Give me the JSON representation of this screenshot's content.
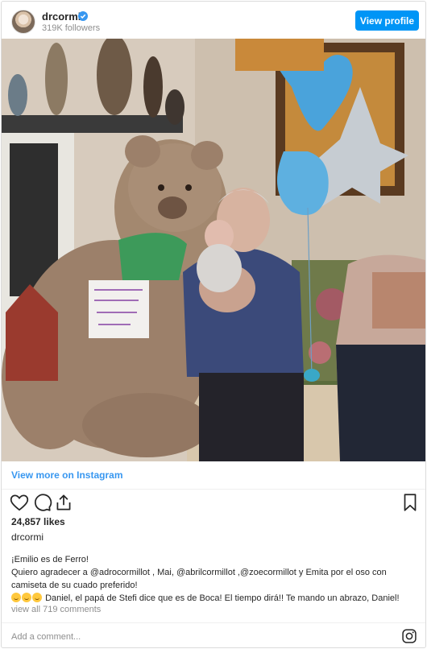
{
  "header": {
    "username": "drcormi",
    "followers": "319K followers",
    "view_profile_label": "View profile"
  },
  "post": {
    "view_more_label": "View more on Instagram",
    "likes": "24,857 likes",
    "owner": "drcormi",
    "caption_line1": "¡Emilio es de Ferro!",
    "caption_line2": "Quiero agradecer a @adrocormillot , Mai, @abrilcormillot ,@zoecormillot y Emita por el oso con camiseta de su cuado preferido!",
    "caption_line3": "Daniel, el papá de Stefi dice que es de Boca! El tiempo dirá!! Te mando un abrazo, Daniel!",
    "view_comments": "view all 719 comments",
    "add_comment_placeholder": "Add a comment..."
  },
  "icons": [
    "verified-badge-icon",
    "heart-icon",
    "comment-icon",
    "share-icon",
    "bookmark-icon",
    "instagram-icon"
  ],
  "colors": {
    "accent": "#0095f6",
    "link": "#3897f0",
    "muted": "#8e8e8e"
  }
}
